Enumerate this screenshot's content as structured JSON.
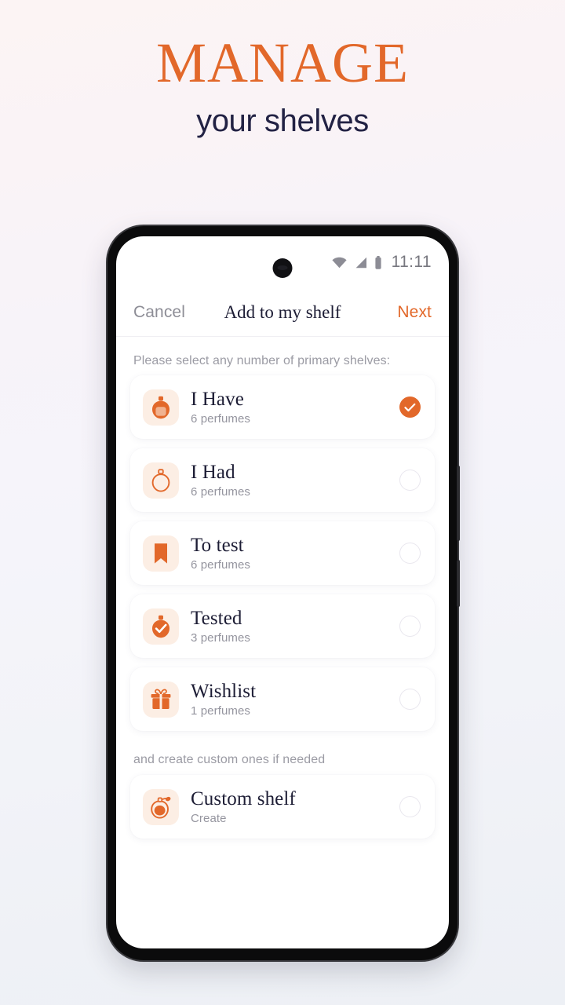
{
  "promo": {
    "title": "MANAGE",
    "subtitle": "your shelves",
    "title_color": "#E2682A",
    "subtitle_color": "#222244"
  },
  "phone": {
    "statusbar": {
      "time": "11:11",
      "icons": [
        "wifi-icon",
        "cellular-signal-icon",
        "battery-icon"
      ]
    },
    "navbar": {
      "cancel_label": "Cancel",
      "title": "Add to my shelf",
      "next_label": "Next",
      "next_color": "#E2682A"
    },
    "content": {
      "primary_helper": "Please select any number of primary shelves:",
      "custom_helper": "and create custom ones if needed",
      "accent_color": "#E2682A",
      "tile_color": "#FCEEE4",
      "primary_shelves": [
        {
          "title": "I Have",
          "subtitle": "6 perfumes",
          "icon": "perfume-bottle-filled-icon",
          "selected": true
        },
        {
          "title": "I Had",
          "subtitle": "6 perfumes",
          "icon": "perfume-bottle-outline-icon",
          "selected": false
        },
        {
          "title": "To test",
          "subtitle": "6 perfumes",
          "icon": "bookmark-icon",
          "selected": false
        },
        {
          "title": "Tested",
          "subtitle": "3 perfumes",
          "icon": "perfume-bottle-check-icon",
          "selected": false
        },
        {
          "title": "Wishlist",
          "subtitle": "1 perfumes",
          "icon": "gift-icon",
          "selected": false
        }
      ],
      "custom_shelves": [
        {
          "title": "Custom shelf",
          "subtitle": "Create",
          "icon": "perfume-atomizer-icon",
          "selected": false
        }
      ]
    }
  }
}
